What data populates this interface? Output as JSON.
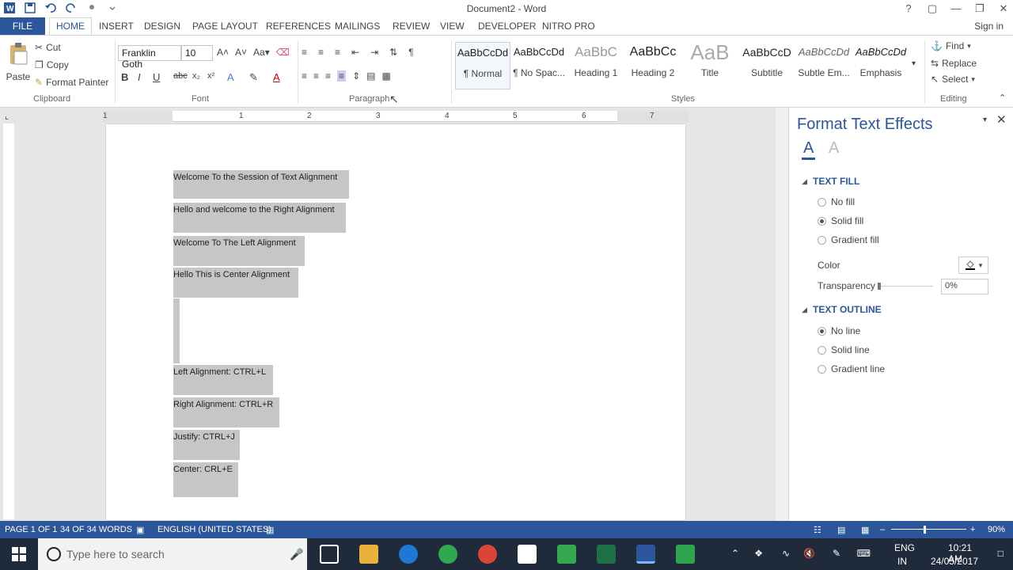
{
  "window": {
    "title": "Document2 - Word",
    "signin": "Sign in"
  },
  "tabs": {
    "file": "FILE",
    "items": [
      "HOME",
      "INSERT",
      "DESIGN",
      "PAGE LAYOUT",
      "REFERENCES",
      "MAILINGS",
      "REVIEW",
      "VIEW",
      "DEVELOPER",
      "NITRO PRO"
    ]
  },
  "clipboard": {
    "paste": "Paste",
    "cut": "Cut",
    "copy": "Copy",
    "format_painter": "Format Painter",
    "label": "Clipboard"
  },
  "font": {
    "name": "Franklin Goth",
    "size": "10",
    "label": "Font"
  },
  "paragraph": {
    "label": "Paragraph"
  },
  "styles": {
    "label": "Styles",
    "items": [
      {
        "preview": "AaBbCcDd",
        "label": "¶ Normal"
      },
      {
        "preview": "AaBbCcDd",
        "label": "¶ No Spac..."
      },
      {
        "preview": "AaBbC",
        "label": "Heading 1"
      },
      {
        "preview": "AaBbCc",
        "label": "Heading 2"
      },
      {
        "preview": "AaB",
        "label": "Title"
      },
      {
        "preview": "AaBbCcD",
        "label": "Subtitle"
      },
      {
        "preview": "AaBbCcDd",
        "label": "Subtle Em..."
      },
      {
        "preview": "AaBbCcDd",
        "label": "Emphasis"
      }
    ]
  },
  "editing": {
    "find": "Find",
    "replace": "Replace",
    "select": "Select",
    "label": "Editing"
  },
  "ruler": {
    "numbers": [
      "1",
      "1",
      "2",
      "3",
      "4",
      "5",
      "6",
      "7"
    ]
  },
  "document": {
    "paragraphs": [
      "Welcome To the Session of Text Alignment",
      "Hello and welcome to the Right Alignment",
      "Welcome To The Left Alignment",
      "Hello This is Center Alignment",
      "Left Alignment: CTRL+L",
      "Right Alignment: CTRL+R",
      "Justify: CTRL+J",
      "Center: CRL+E"
    ]
  },
  "pane": {
    "title": "Format Text Effects",
    "text_fill": "TEXT FILL",
    "fill_options": [
      "No fill",
      "Solid fill",
      "Gradient fill"
    ],
    "fill_selected": "Solid fill",
    "color_label": "Color",
    "transparency_label": "Transparency",
    "transparency_value": "0%",
    "text_outline": "TEXT OUTLINE",
    "outline_options": [
      "No line",
      "Solid line",
      "Gradient line"
    ],
    "outline_selected": "No line"
  },
  "status": {
    "page": "PAGE 1 OF 1",
    "words": "34 OF 34 WORDS",
    "language": "ENGLISH (UNITED STATES)",
    "zoom": "90%"
  },
  "taskbar": {
    "search_placeholder": "Type here to search",
    "lang": "ENG",
    "region": "IN",
    "time": "10:21 AM",
    "date": "24/05/2017"
  },
  "colors": {
    "accent": "#2b579a",
    "selection": "#c6c6c6",
    "taskbar": "#1f2b3a"
  }
}
